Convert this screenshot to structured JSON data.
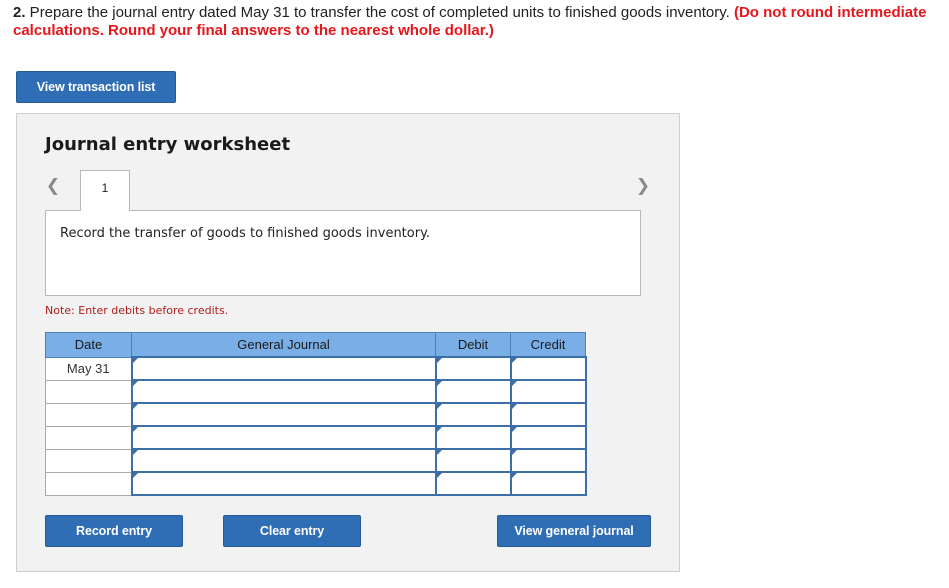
{
  "question": {
    "number": "2.",
    "text": " Prepare the journal entry dated May 31 to transfer the cost of completed units to finished goods inventory. ",
    "warning": "(Do not round intermediate calculations. Round your final answers to the nearest whole dollar.)"
  },
  "buttons": {
    "view_transaction_list": "View transaction list",
    "record_entry": "Record entry",
    "clear_entry": "Clear entry",
    "view_general_journal": "View general journal"
  },
  "worksheet": {
    "title": "Journal entry worksheet",
    "prev_icon": "chevron-left-icon",
    "next_icon": "chevron-right-icon",
    "active_tab": "1",
    "description": "Record the transfer of goods to finished goods inventory.",
    "note": "Note: Enter debits before credits."
  },
  "journal_table": {
    "headers": {
      "date": "Date",
      "general_journal": "General Journal",
      "debit": "Debit",
      "credit": "Credit"
    },
    "rows": [
      {
        "date": "May 31",
        "account": "",
        "debit": "",
        "credit": ""
      },
      {
        "date": "",
        "account": "",
        "debit": "",
        "credit": ""
      },
      {
        "date": "",
        "account": "",
        "debit": "",
        "credit": ""
      },
      {
        "date": "",
        "account": "",
        "debit": "",
        "credit": ""
      },
      {
        "date": "",
        "account": "",
        "debit": "",
        "credit": ""
      },
      {
        "date": "",
        "account": "",
        "debit": "",
        "credit": ""
      }
    ]
  },
  "colors": {
    "button_blue": "#2f6db5",
    "header_blue": "#7aaee6",
    "warning_red": "#e5171d",
    "note_red": "#b01e1e",
    "panel_gray": "#f2f2f2"
  }
}
